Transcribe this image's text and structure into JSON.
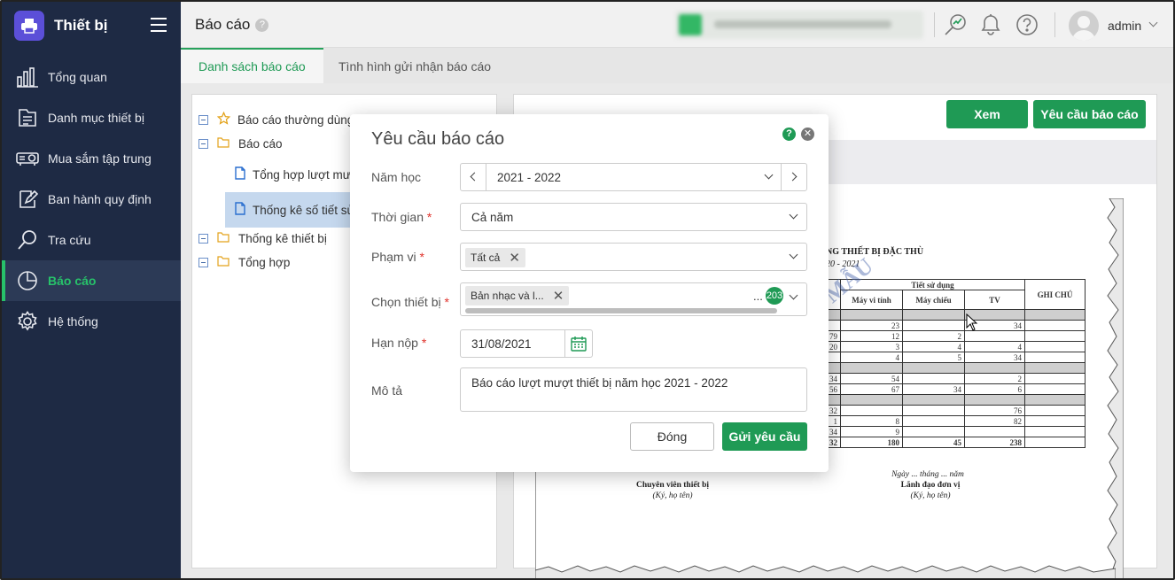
{
  "app": {
    "name": "Thiết bị"
  },
  "sidebar": {
    "items": [
      {
        "label": "Tổng quan",
        "icon": "bar-chart-icon"
      },
      {
        "label": "Danh mục thiết bị",
        "icon": "list-document-icon"
      },
      {
        "label": "Mua sắm tập trung",
        "icon": "projector-icon"
      },
      {
        "label": "Ban hành quy định",
        "icon": "edit-icon"
      },
      {
        "label": "Tra cứu",
        "icon": "search-icon"
      },
      {
        "label": "Báo cáo",
        "icon": "pie-chart-icon",
        "active": true
      },
      {
        "label": "Hệ thống",
        "icon": "gear-icon"
      }
    ]
  },
  "header": {
    "title": "Báo cáo",
    "help": "?",
    "user": "admin"
  },
  "tabs": [
    {
      "label": "Danh sách báo cáo",
      "active": true
    },
    {
      "label": "Tình hình gửi nhận báo cáo",
      "active": false
    }
  ],
  "tree": {
    "items": [
      {
        "label": "Báo cáo thường dùng",
        "icon": "star-icon"
      },
      {
        "label": "Báo cáo",
        "icon": "folder-icon"
      },
      {
        "label": "Tổng hợp lượt mượn",
        "icon": "file-icon"
      },
      {
        "label": "Thống kê số tiết sử dụng",
        "icon": "file-icon"
      },
      {
        "label": "Thống kê thiết bị",
        "icon": "folder-icon"
      },
      {
        "label": "Tổng hợp",
        "icon": "folder-icon"
      }
    ]
  },
  "toolbar": {
    "view_label": "Xem",
    "request_label": "Yêu cầu báo cáo"
  },
  "document": {
    "title": "NG THIẾT BỊ ĐẶC THÙ",
    "subtitle": "20 - 2021",
    "watermark": "MẪU",
    "headers": {
      "group": "Tiết sử dụng",
      "c1": "Máy vi tính",
      "c2": "Máy chiếu",
      "c3": "TV",
      "note": "GHI CHÚ"
    },
    "rows": [
      [
        "",
        "",
        "",
        ""
      ],
      [
        "",
        "23",
        "",
        "34"
      ],
      [
        "79",
        "12",
        "2",
        ""
      ],
      [
        "20",
        "3",
        "4",
        "4"
      ],
      [
        "",
        "4",
        "5",
        "34"
      ],
      [
        "",
        "",
        "",
        ""
      ],
      [
        "34",
        "54",
        "",
        "2"
      ],
      [
        "56",
        "67",
        "34",
        "6"
      ],
      [
        "",
        "",
        "",
        ""
      ],
      [
        "32",
        "",
        "",
        "76"
      ],
      [
        "1",
        "8",
        "",
        "82"
      ],
      [
        "34",
        "9",
        "",
        ""
      ],
      [
        "32",
        "180",
        "45",
        "238"
      ]
    ],
    "date_line": "Ngày ... tháng ... năm",
    "sign_left_title": "Chuyên viên thiết bị",
    "sign_left_sub": "(Ký, họ tên)",
    "sign_right_title": "Lãnh đạo đơn vị",
    "sign_right_sub": "(Ký, họ tên)"
  },
  "modal": {
    "title": "Yêu cầu báo cáo",
    "help": "?",
    "fields": {
      "school_year": {
        "label": "Năm học",
        "value": "2021 - 2022"
      },
      "period": {
        "label": "Thời gian",
        "value": "Cả năm"
      },
      "scope": {
        "label": "Phạm vi",
        "chip": "Tất cả"
      },
      "device": {
        "label": "Chọn thiết bị",
        "chip": "Bản nhạc và l...",
        "more": "...",
        "count": "203"
      },
      "deadline": {
        "label": "Hạn nộp",
        "value": "31/08/2021"
      },
      "description": {
        "label": "Mô tả",
        "value": "Báo cáo lượt mượt thiết bị năm học 2021 - 2022"
      }
    },
    "close_label": "Đóng",
    "submit_label": "Gửi yêu cầu"
  },
  "colors": {
    "sidebar": "#1e2a44",
    "accent": "#1f9a55",
    "active_nav": "#27c26a",
    "brand": "#5b4fd8"
  }
}
